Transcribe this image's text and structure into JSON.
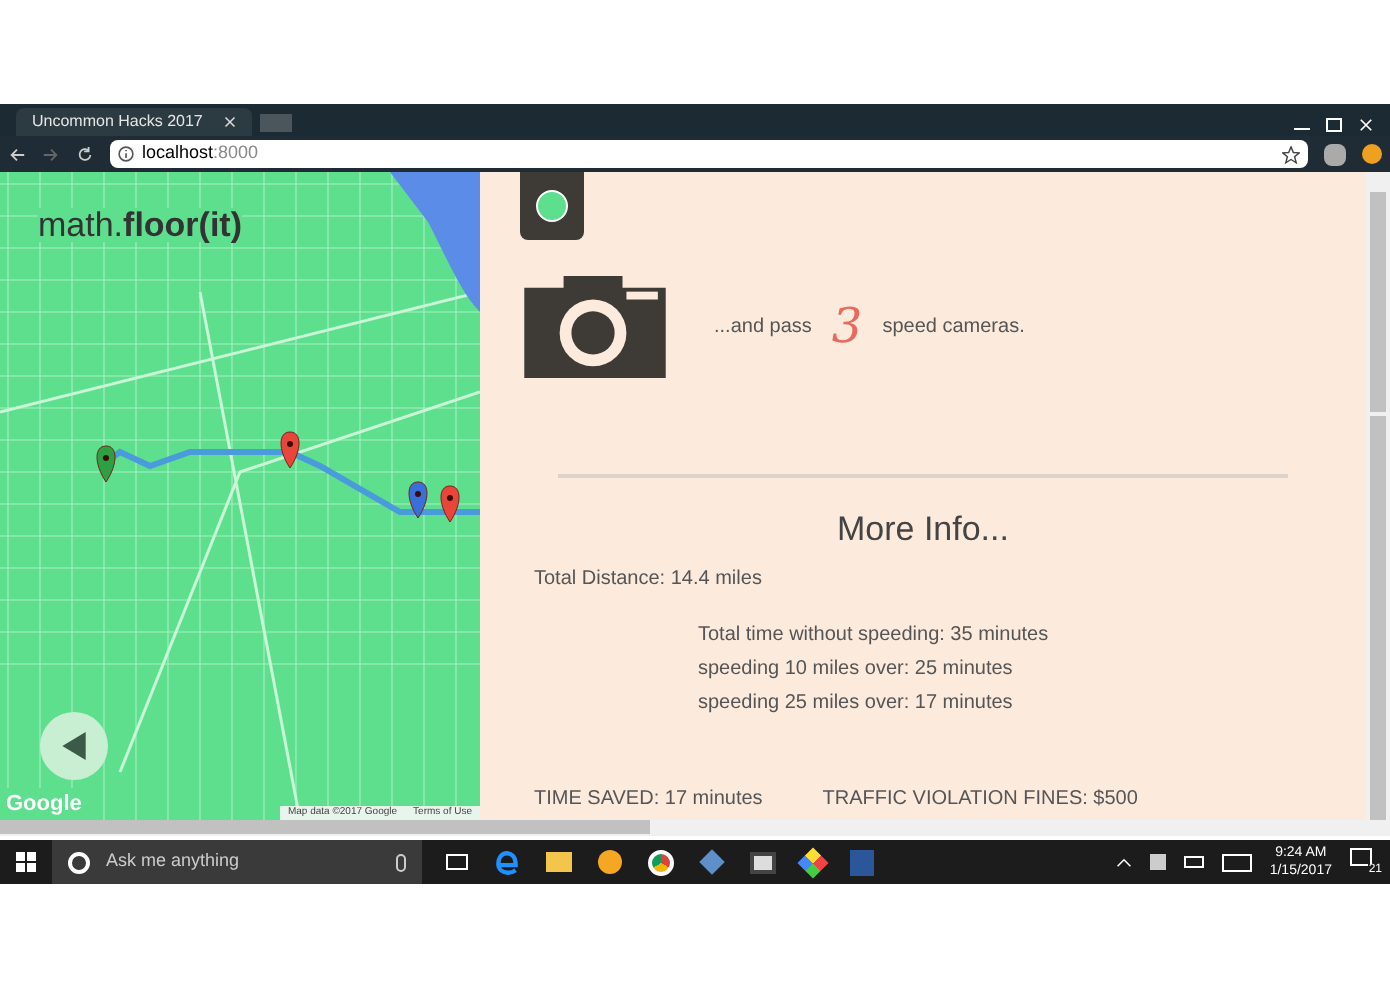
{
  "browser": {
    "tab_title": "Uncommon Hacks 2017",
    "url_host": "localhost",
    "url_port": ":8000"
  },
  "map": {
    "logo": "math.",
    "logo_bold": "floor(it)",
    "attribution": "Google",
    "map_data": "Map data ©2017 Google",
    "terms": "Terms of Use"
  },
  "results": {
    "cameras_prefix": "...and pass",
    "cameras_count": "3",
    "cameras_suffix": "speed cameras.",
    "heading": "More Info...",
    "total_distance": "Total Distance: 14.4 miles",
    "times": [
      "Total time without speeding: 35 minutes",
      "speeding 10 miles over: 25 minutes",
      "speeding 25 miles over: 17 minutes"
    ],
    "time_saved": "TIME SAVED: 17 minutes",
    "fines": "TRAFFIC VIOLATION FINES: $500"
  },
  "taskbar": {
    "search_placeholder": "Ask me anything",
    "time": "9:24 AM",
    "date": "1/15/2017",
    "notifications": "21"
  }
}
